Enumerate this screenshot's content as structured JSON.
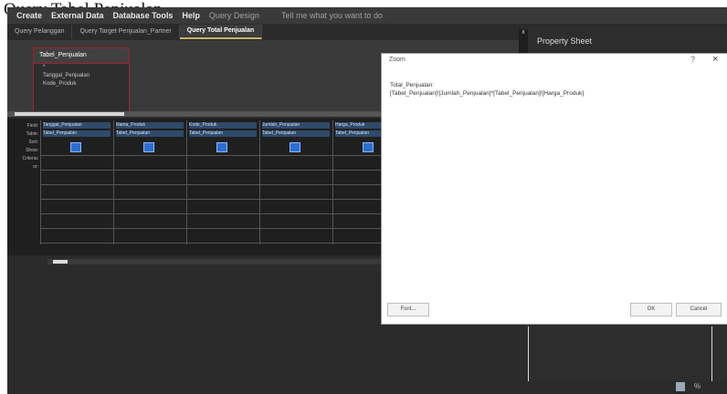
{
  "caption": "Query Tabel Penjualan",
  "ribbon": {
    "items": [
      "Create",
      "External Data",
      "Database Tools",
      "Help",
      "Query Design",
      "Tell me what you want to do"
    ]
  },
  "tabs": [
    {
      "label": "Query Pelanggan",
      "active": false
    },
    {
      "label": "Query Target Penjualan_Partner",
      "active": false
    },
    {
      "label": "Query Total Penjualan",
      "active": true
    }
  ],
  "upper": {
    "table_title": "Tabel_Penjualan",
    "fields": [
      "*",
      "Tanggal_Penjualan",
      "Kode_Produk"
    ]
  },
  "grid": {
    "row_labels": [
      "Field:",
      "Table:",
      "Sort:",
      "Show:",
      "Criteria:",
      "or:"
    ],
    "columns": [
      {
        "field": "Tanggal_Penjualan",
        "table": "Tabel_Penjualan"
      },
      {
        "field": "Nama_Produk",
        "table": "Tabel_Penjualan"
      },
      {
        "field": "Kode_Produk",
        "table": "Tabel_Penjualan"
      },
      {
        "field": "Jumlah_Penjualan",
        "table": "Tabel_Penjualan"
      },
      {
        "field": "Harga_Produk",
        "table": "Tabel_Penjualan"
      }
    ]
  },
  "property_sheet": {
    "title": "Property Sheet",
    "toggle": "x"
  },
  "zoom_dialog": {
    "title": "Zoom",
    "help": "?",
    "close": "×",
    "expression": "Total_Penjualan:\n[Tabel_Penjualan]![Jumlah_Penjualan]*[Tabel_Penjualan]![Harga_Produk]",
    "font_button": "Font...",
    "ok_button": "OK",
    "cancel_button": "Cancel"
  },
  "status": {
    "zoom_label": "%"
  }
}
